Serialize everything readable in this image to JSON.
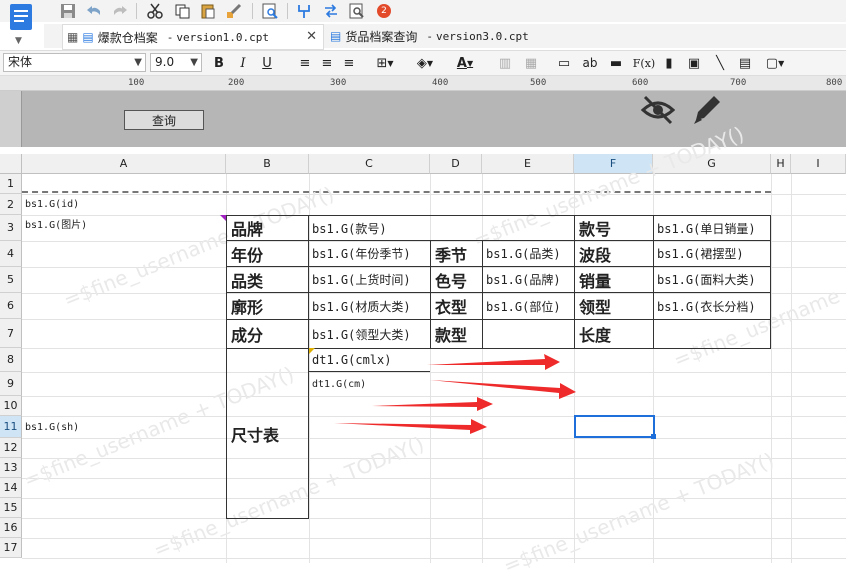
{
  "tabs": [
    {
      "name": "爆款仓档案",
      "version": "version1.0.cpt"
    },
    {
      "name": "货品档案查询",
      "version": "version3.0.cpt"
    }
  ],
  "toolbar": {
    "badge_count": "2"
  },
  "format": {
    "font": "宋体",
    "size": "9.0",
    "fx": "F(x)",
    "ab": "ab"
  },
  "ruler": [
    "100",
    "200",
    "300",
    "400",
    "500",
    "600",
    "700",
    "800"
  ],
  "param": {
    "query_button": "查询"
  },
  "columns": [
    "A",
    "B",
    "C",
    "D",
    "E",
    "F",
    "G",
    "H",
    "I"
  ],
  "rows": [
    "1",
    "2",
    "3",
    "4",
    "5",
    "6",
    "7",
    "8",
    "9",
    "10",
    "11",
    "12",
    "13",
    "14",
    "15",
    "16",
    "17"
  ],
  "cells": {
    "a2": "bs1.G(id)",
    "a3": "bs1.G(图片)",
    "a11": "bs1.G(sh)",
    "b3": "品牌",
    "c3": "bs1.G(款号)",
    "f3": "款号",
    "g3": "bs1.G(单日销量)",
    "b4": "年份",
    "c4": "bs1.G(年份季节)",
    "d4": "季节",
    "e4": "bs1.G(品类)",
    "f4": "波段",
    "g4": "bs1.G(裙摆型)",
    "b5": "品类",
    "c5": "bs1.G(上货时间)",
    "d5": "色号",
    "e5": "bs1.G(品牌)",
    "f5": "销量",
    "g5": "bs1.G(面料大类)",
    "b6": "廓形",
    "c6": "bs1.G(材质大类)",
    "d6": "衣型",
    "e6": "bs1.G(部位)",
    "f6": "领型",
    "g6": "bs1.G(衣长分档)",
    "b7": "成分",
    "c7": "bs1.G(领型大类)",
    "d7": "款型",
    "f7": "长度",
    "b8": "尺寸表",
    "c8": "dt1.G(cmlx)",
    "c9": "dt1.G(cm)"
  },
  "watermark": "=$fine_username + TODAY()",
  "colors": {
    "accent": "#1e6fd9",
    "arrow": "#ee2a2a",
    "param_bg": "#b6b6b6",
    "selected_col": "#cfe4f5"
  }
}
